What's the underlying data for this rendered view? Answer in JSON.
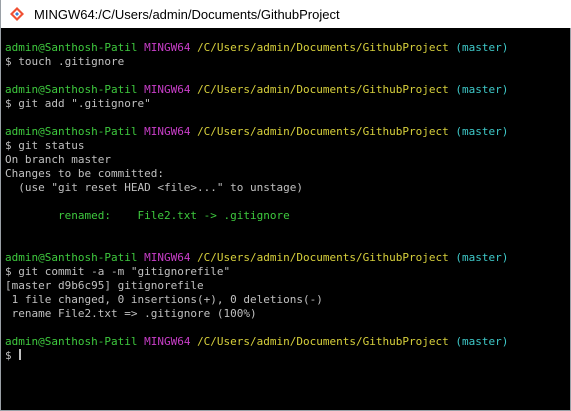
{
  "window": {
    "title": "MINGW64:/C/Users/admin/Documents/GithubProject",
    "icon": "git-bash-icon"
  },
  "prompt": {
    "user_host": "admin@Santhosh-Patil",
    "system": "MINGW64",
    "path": "/C/Users/admin/Documents/GithubProject",
    "branch": "(master)",
    "symbol": "$"
  },
  "commands": {
    "c1": "touch .gitignore",
    "c2": "git add \".gitignore\"",
    "c3": "git status",
    "c4": "git commit -a -m \"gitignorefile\""
  },
  "output": {
    "status_line1": "On branch master",
    "status_line2": "Changes to be committed:",
    "status_line3": "  (use \"git reset HEAD <file>...\" to unstage)",
    "status_renamed": "        renamed:    File2.txt -> .gitignore",
    "commit_line1": "[master d9b6c95] gitignorefile",
    "commit_line2": " 1 file changed, 0 insertions(+), 0 deletions(-)",
    "commit_line3": " rename File2.txt => .gitignore (100%)"
  },
  "colors": {
    "user": "#3ec93e",
    "system": "#c93ec9",
    "path": "#d7d03c",
    "branch": "#3ec9c9",
    "text": "#c0c0c0",
    "background": "#000000"
  }
}
